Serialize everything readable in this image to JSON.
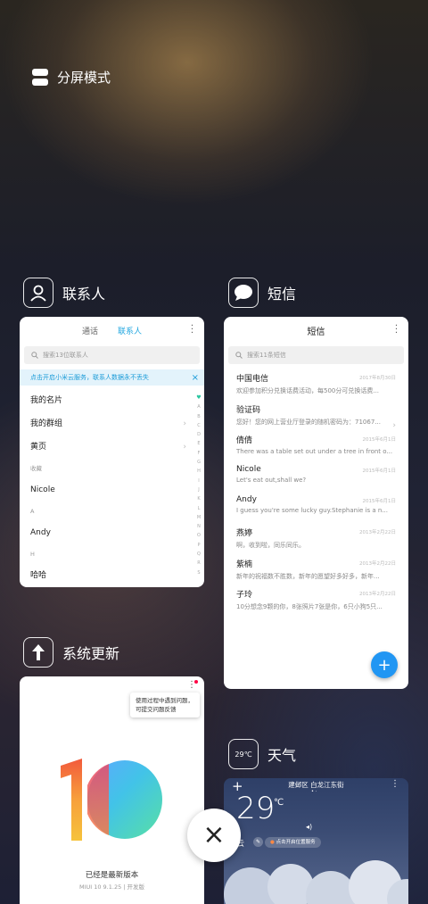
{
  "split_screen": {
    "label": "分屏模式",
    "icon": "split-screen-icon"
  },
  "contacts": {
    "app_title": "联系人",
    "tabs": [
      "通话",
      "联系人"
    ],
    "active_tab": 1,
    "search_placeholder": "搜索13位联系人",
    "banner": "点击开启小米云服务，联系人数据永不丢失",
    "rows": [
      {
        "kind": "item",
        "label": "我的名片",
        "chev": false
      },
      {
        "kind": "item",
        "label": "我的群组",
        "chev": true
      },
      {
        "kind": "item",
        "label": "黄页",
        "chev": true
      },
      {
        "kind": "section",
        "label": "收藏"
      },
      {
        "kind": "item",
        "label": "Nicole",
        "chev": false
      },
      {
        "kind": "section",
        "label": "A"
      },
      {
        "kind": "item",
        "label": "Andy",
        "chev": false
      },
      {
        "kind": "section",
        "label": "H"
      },
      {
        "kind": "item",
        "label": "哈哈",
        "chev": false
      }
    ],
    "alphabet": [
      "A",
      "B",
      "C",
      "D",
      "E",
      "F",
      "G",
      "H",
      "I",
      "J",
      "K",
      "L",
      "M",
      "N",
      "O",
      "P",
      "Q",
      "R",
      "S"
    ]
  },
  "sms": {
    "app_title": "短信",
    "header": "短信",
    "search_placeholder": "搜索11条短信",
    "messages": [
      {
        "name": "中国电信",
        "date": "2017年8月30日",
        "preview": "欢迎参加积分兑换话费活动，每500分可兑换话费...",
        "chev": false
      },
      {
        "name": "验证码",
        "date": "",
        "preview": "您好！您的网上营业厅登录的随机密码为：71067...",
        "chev": true
      },
      {
        "name": "倩倩",
        "date": "2015年6月1日",
        "preview": "There was a table set out under a tree in front o...",
        "chev": false
      },
      {
        "name": "Nicole",
        "date": "2015年6月1日",
        "preview": "Let's eat out,shall we?",
        "chev": false
      },
      {
        "name": "Andy",
        "date": "2015年6月1日",
        "preview": "I guess you're some lucky guy.Stephanie is a n...",
        "chev": false
      },
      {
        "name": "燕婷",
        "date": "2013年2月22日",
        "preview": "啊，收到啦，同乐同乐。",
        "chev": false
      },
      {
        "name": "紫楠",
        "date": "2013年2月22日",
        "preview": "新年的祝福数不胜数，新年的愿望好多好多，新年...",
        "chev": false
      },
      {
        "name": "子玲",
        "date": "2013年2月22日",
        "preview": "10分想念9颗的你，8张照片7张是你，6只小狗5只...",
        "chev": false
      }
    ],
    "fab_label": "+"
  },
  "update": {
    "app_title": "系统更新",
    "tooltip": "使用过程中遇到问题，可提交问题反馈",
    "status": "已经是最新版本",
    "version": "MIUI 10 9.1.25 | 开发版"
  },
  "weather": {
    "app_title": "天气",
    "icon_label": "29℃",
    "location": "建邺区 白龙江东街",
    "temp": "29",
    "unit": "℃",
    "condition": "云",
    "location_tip": "点击开启位置服务"
  },
  "close_button": "×"
}
